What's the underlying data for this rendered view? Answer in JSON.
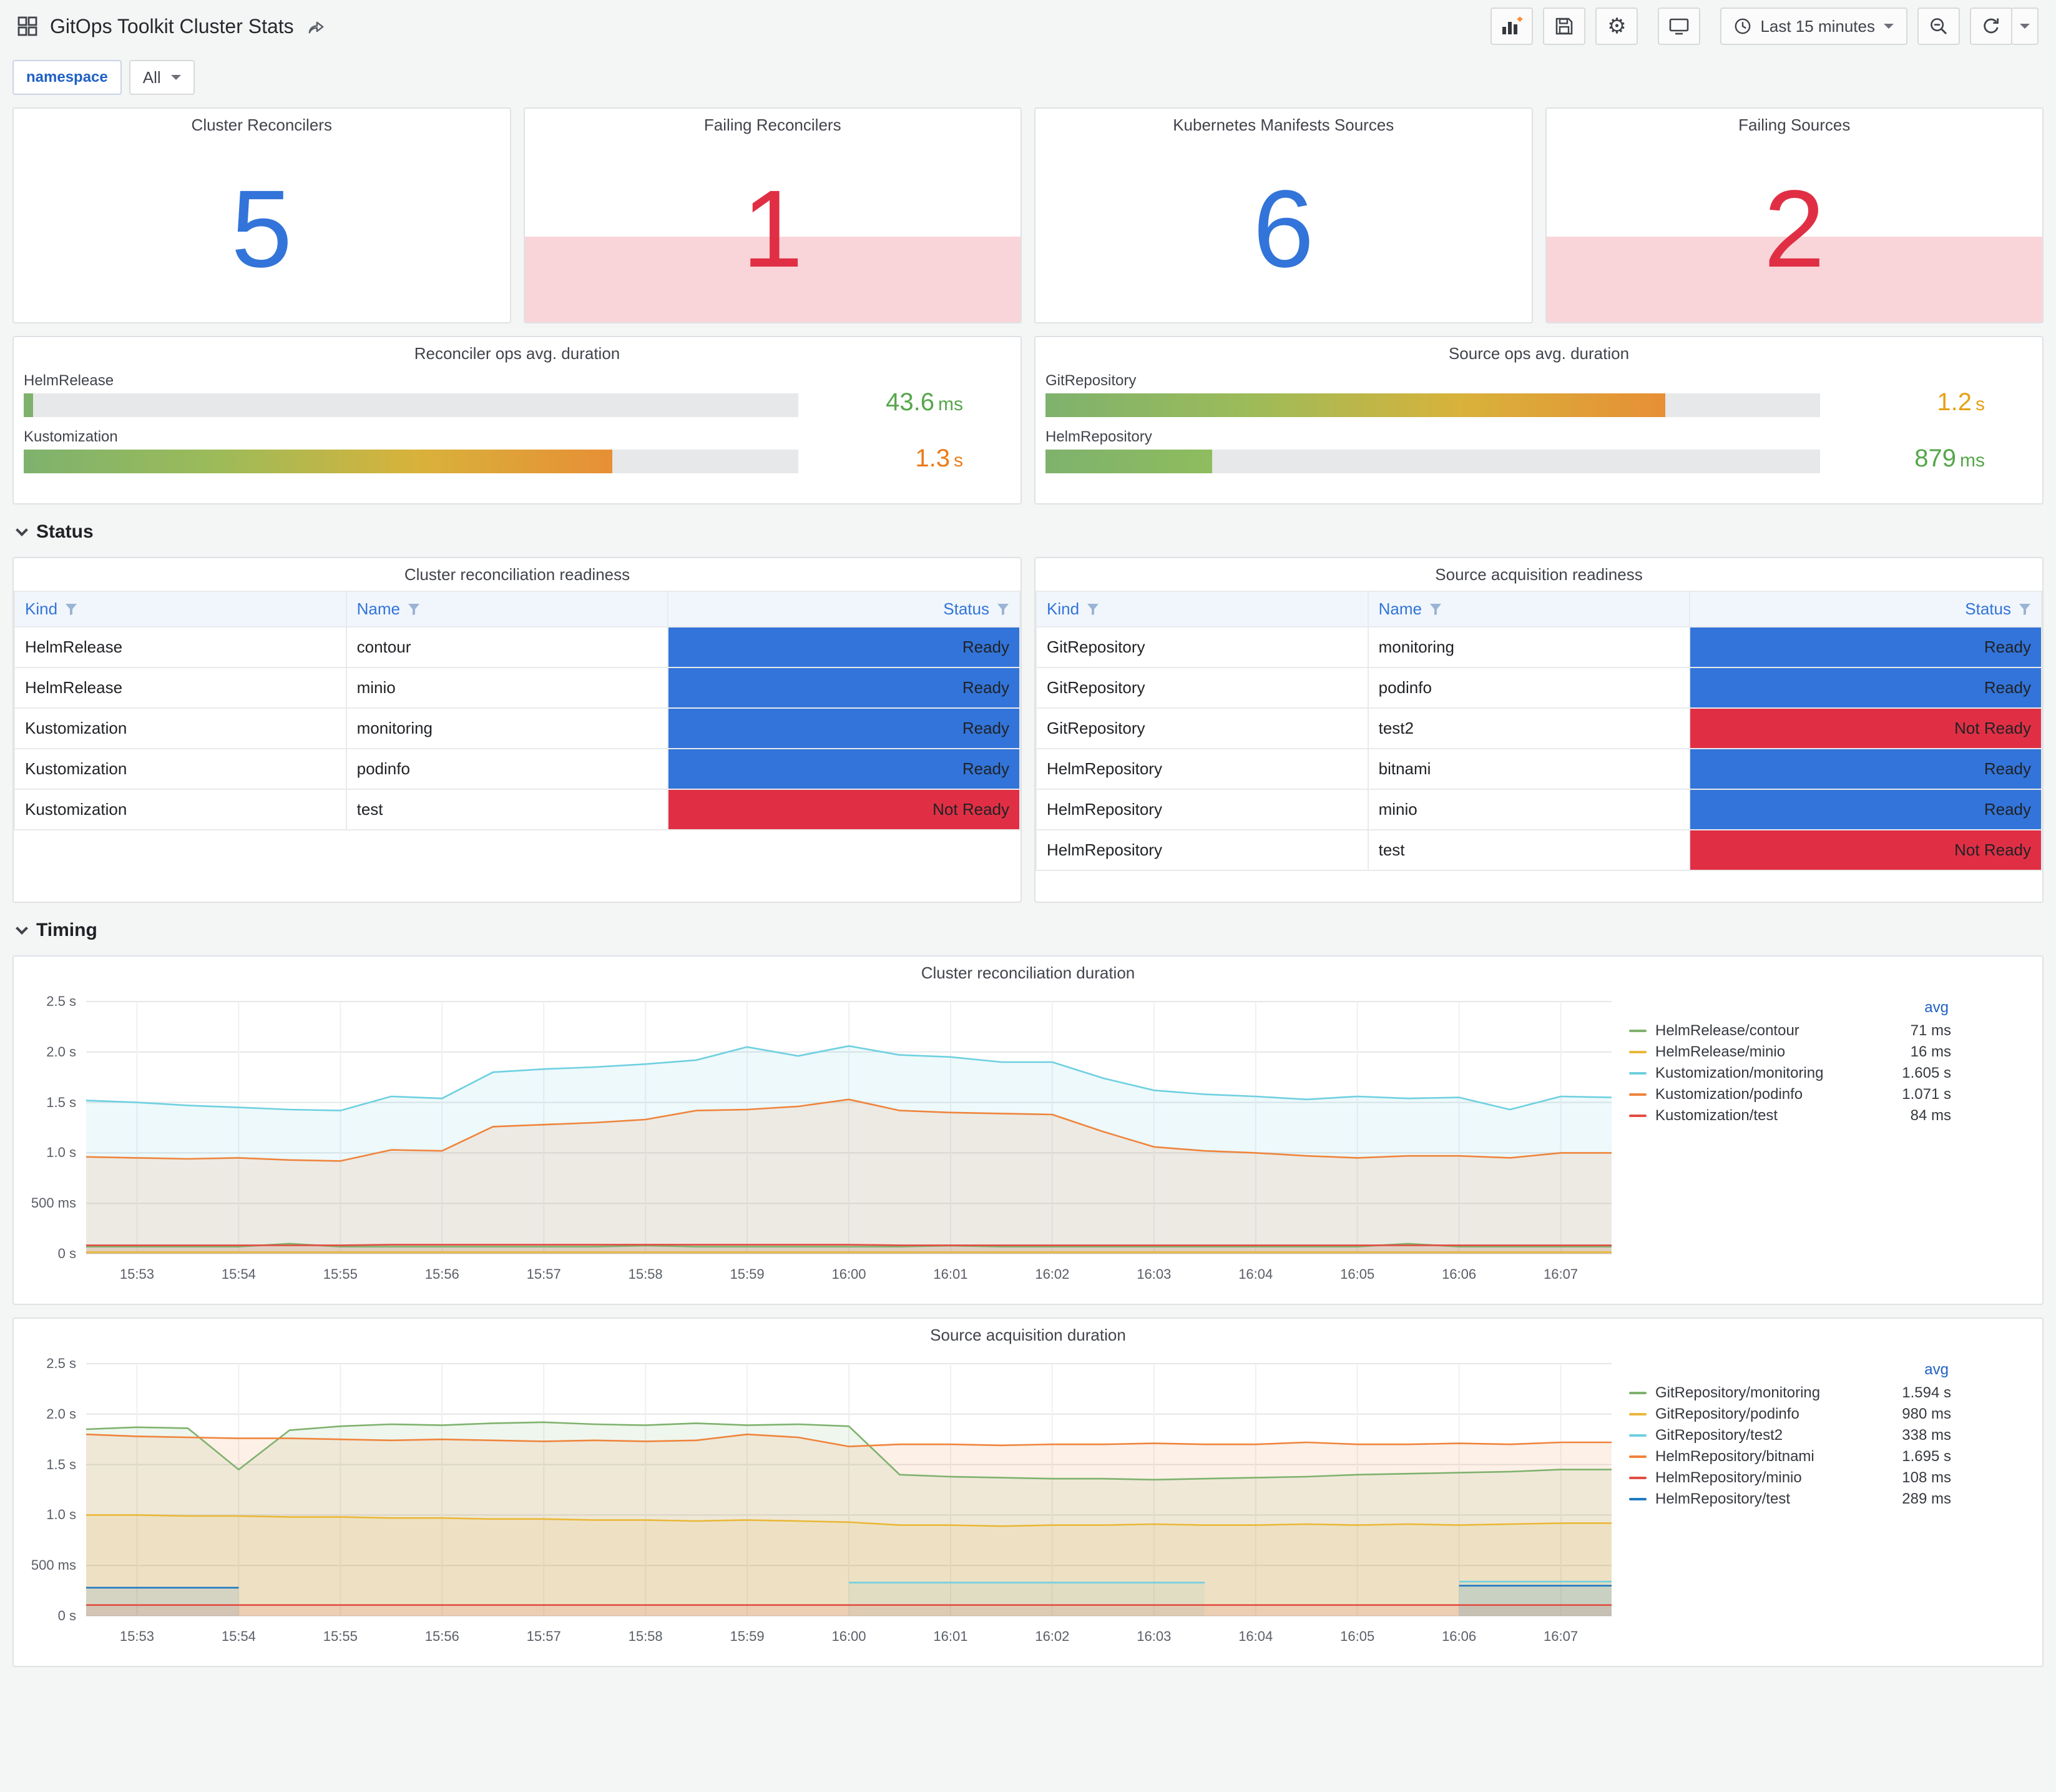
{
  "header": {
    "title": "GitOps Toolkit Cluster Stats",
    "time_picker": "Last 15 minutes"
  },
  "variables": {
    "label": "namespace",
    "value": "All"
  },
  "stats": [
    {
      "title": "Cluster Reconcilers",
      "value": "5",
      "color": "#3274D9",
      "alert": false
    },
    {
      "title": "Failing Reconcilers",
      "value": "1",
      "color": "#E02F44",
      "alert": true
    },
    {
      "title": "Kubernetes Manifests Sources",
      "value": "6",
      "color": "#3274D9",
      "alert": false
    },
    {
      "title": "Failing Sources",
      "value": "2",
      "color": "#E02F44",
      "alert": true
    }
  ],
  "gauges": [
    {
      "title": "Reconciler ops avg. duration",
      "rows": [
        {
          "label": "HelmRelease",
          "value": "43.6",
          "unit": "ms",
          "value_color": "#56A64B",
          "fraction": 0.012,
          "bar_stops": [
            "#7EB26D"
          ]
        },
        {
          "label": "Kustomization",
          "value": "1.3",
          "unit": "s",
          "value_color": "#EB7B18",
          "fraction": 0.76,
          "bar_stops": [
            "#7EB26D",
            "#9DBB59",
            "#D8B23B",
            "#E78F35"
          ]
        }
      ]
    },
    {
      "title": "Source ops avg. duration",
      "rows": [
        {
          "label": "GitRepository",
          "value": "1.2",
          "unit": "s",
          "value_color": "#E5A117",
          "fraction": 0.8,
          "bar_stops": [
            "#7EB26D",
            "#9DBB59",
            "#D8B23B",
            "#E78F35"
          ]
        },
        {
          "label": "HelmRepository",
          "value": "879",
          "unit": "ms",
          "value_color": "#56A64B",
          "fraction": 0.215,
          "bar_stops": [
            "#7EB26D",
            "#8FBC5E"
          ]
        }
      ]
    }
  ],
  "sections": {
    "status": "Status",
    "timing": "Timing"
  },
  "tables": [
    {
      "title": "Cluster reconciliation readiness",
      "columns": [
        "Kind",
        "Name",
        "Status"
      ],
      "rows": [
        [
          "HelmRelease",
          "contour",
          "Ready"
        ],
        [
          "HelmRelease",
          "minio",
          "Ready"
        ],
        [
          "Kustomization",
          "monitoring",
          "Ready"
        ],
        [
          "Kustomization",
          "podinfo",
          "Ready"
        ],
        [
          "Kustomization",
          "test",
          "Not Ready"
        ]
      ]
    },
    {
      "title": "Source acquisition readiness",
      "columns": [
        "Kind",
        "Name",
        "Status"
      ],
      "rows": [
        [
          "GitRepository",
          "monitoring",
          "Ready"
        ],
        [
          "GitRepository",
          "podinfo",
          "Ready"
        ],
        [
          "GitRepository",
          "test2",
          "Not Ready"
        ],
        [
          "HelmRepository",
          "bitnami",
          "Ready"
        ],
        [
          "HelmRepository",
          "minio",
          "Ready"
        ],
        [
          "HelmRepository",
          "test",
          "Not Ready"
        ]
      ]
    }
  ],
  "status_colors": {
    "Ready": "#3274D9",
    "Not Ready": "#E02F44"
  },
  "chart_data": [
    {
      "type": "line",
      "title": "Cluster reconciliation duration",
      "legend_header": "avg",
      "ylim": [
        0,
        2.5
      ],
      "y_tick_values": [
        0,
        0.5,
        1.0,
        1.5,
        2.0,
        2.5
      ],
      "y_ticks": [
        "0 s",
        "500 ms",
        "1.0 s",
        "1.5 s",
        "2.0 s",
        "2.5 s"
      ],
      "x_ticks": [
        "15:53",
        "15:54",
        "15:55",
        "15:56",
        "15:57",
        "15:58",
        "15:59",
        "16:00",
        "16:01",
        "16:02",
        "16:03",
        "16:04",
        "16:05",
        "16:06",
        "16:07"
      ],
      "series": [
        {
          "name": "HelmRelease/contour",
          "avg": "71 ms",
          "color": "#7EB26D",
          "values": [
            0.07,
            0.07,
            0.07,
            0.07,
            0.1,
            0.07,
            0.07,
            0.07,
            0.07,
            0.07,
            0.07,
            0.08,
            0.07,
            0.07,
            0.07,
            0.07,
            0.07,
            0.08,
            0.07,
            0.07,
            0.07,
            0.07,
            0.07,
            0.07,
            0.07,
            0.07,
            0.1,
            0.07,
            0.07,
            0.07,
            0.07
          ]
        },
        {
          "name": "HelmRelease/minio",
          "avg": "16 ms",
          "color": "#EAB839",
          "values": [
            0.016,
            0.016,
            0.016,
            0.016,
            0.016,
            0.016,
            0.016,
            0.016,
            0.016,
            0.016,
            0.016,
            0.016,
            0.016,
            0.016,
            0.016,
            0.016,
            0.016,
            0.016,
            0.016,
            0.016,
            0.016,
            0.016,
            0.016,
            0.016,
            0.016,
            0.016,
            0.016,
            0.016,
            0.016,
            0.016,
            0.016
          ]
        },
        {
          "name": "Kustomization/monitoring",
          "avg": "1.605 s",
          "color": "#6ED0E0",
          "values": [
            1.52,
            1.5,
            1.47,
            1.45,
            1.43,
            1.42,
            1.56,
            1.54,
            1.8,
            1.83,
            1.85,
            1.88,
            1.92,
            2.05,
            1.96,
            2.06,
            1.97,
            1.95,
            1.9,
            1.9,
            1.74,
            1.62,
            1.58,
            1.56,
            1.53,
            1.56,
            1.54,
            1.55,
            1.43,
            1.56,
            1.55
          ]
        },
        {
          "name": "Kustomization/podinfo",
          "avg": "1.071 s",
          "color": "#EF843C",
          "values": [
            0.96,
            0.95,
            0.94,
            0.95,
            0.93,
            0.92,
            1.03,
            1.02,
            1.26,
            1.28,
            1.3,
            1.33,
            1.42,
            1.43,
            1.46,
            1.53,
            1.42,
            1.4,
            1.39,
            1.38,
            1.21,
            1.06,
            1.02,
            1.0,
            0.97,
            0.95,
            0.97,
            0.97,
            0.95,
            1.0,
            1.0
          ]
        },
        {
          "name": "Kustomization/test",
          "avg": "84 ms",
          "color": "#E24D42",
          "values": [
            0.084,
            0.084,
            0.084,
            0.084,
            0.084,
            0.084,
            0.09,
            0.09,
            0.09,
            0.09,
            0.09,
            0.09,
            0.09,
            0.09,
            0.09,
            0.09,
            0.084,
            0.084,
            0.084,
            0.084,
            0.084,
            0.084,
            0.084,
            0.084,
            0.084,
            0.084,
            0.084,
            0.084,
            0.084,
            0.084,
            0.084
          ]
        }
      ]
    },
    {
      "type": "line",
      "title": "Source acquisition duration",
      "legend_header": "avg",
      "ylim": [
        0,
        2.5
      ],
      "y_tick_values": [
        0,
        0.5,
        1.0,
        1.5,
        2.0,
        2.5
      ],
      "y_ticks": [
        "0 s",
        "500 ms",
        "1.0 s",
        "1.5 s",
        "2.0 s",
        "2.5 s"
      ],
      "x_ticks": [
        "15:53",
        "15:54",
        "15:55",
        "15:56",
        "15:57",
        "15:58",
        "15:59",
        "16:00",
        "16:01",
        "16:02",
        "16:03",
        "16:04",
        "16:05",
        "16:06",
        "16:07"
      ],
      "series": [
        {
          "name": "GitRepository/monitoring",
          "avg": "1.594 s",
          "color": "#7EB26D",
          "values": [
            1.85,
            1.87,
            1.86,
            1.45,
            1.84,
            1.88,
            1.9,
            1.89,
            1.91,
            1.92,
            1.9,
            1.89,
            1.91,
            1.89,
            1.9,
            1.88,
            1.4,
            1.38,
            1.37,
            1.36,
            1.36,
            1.35,
            1.36,
            1.37,
            1.38,
            1.4,
            1.41,
            1.42,
            1.43,
            1.45,
            1.45
          ]
        },
        {
          "name": "GitRepository/podinfo",
          "avg": "980 ms",
          "color": "#EAB839",
          "values": [
            1.0,
            1.0,
            0.99,
            0.99,
            0.98,
            0.98,
            0.97,
            0.97,
            0.96,
            0.96,
            0.95,
            0.95,
            0.94,
            0.95,
            0.94,
            0.93,
            0.9,
            0.9,
            0.89,
            0.9,
            0.9,
            0.91,
            0.9,
            0.9,
            0.91,
            0.9,
            0.91,
            0.9,
            0.91,
            0.92,
            0.92
          ]
        },
        {
          "name": "GitRepository/test2",
          "avg": "338 ms",
          "color": "#6ED0E0",
          "values": [
            null,
            null,
            null,
            null,
            null,
            null,
            null,
            null,
            null,
            null,
            null,
            null,
            null,
            null,
            null,
            0.33,
            0.33,
            0.33,
            0.33,
            0.33,
            0.33,
            0.33,
            0.33,
            null,
            null,
            null,
            null,
            0.34,
            0.34,
            0.34,
            0.34
          ]
        },
        {
          "name": "HelmRepository/bitnami",
          "avg": "1.695 s",
          "color": "#EF843C",
          "values": [
            1.8,
            1.78,
            1.77,
            1.76,
            1.76,
            1.75,
            1.74,
            1.75,
            1.74,
            1.73,
            1.74,
            1.73,
            1.74,
            1.8,
            1.77,
            1.68,
            1.7,
            1.7,
            1.69,
            1.7,
            1.7,
            1.71,
            1.7,
            1.7,
            1.72,
            1.7,
            1.7,
            1.71,
            1.7,
            1.72,
            1.72
          ]
        },
        {
          "name": "HelmRepository/minio",
          "avg": "108 ms",
          "color": "#E24D42",
          "values": [
            0.108,
            0.108,
            0.108,
            0.108,
            0.108,
            0.108,
            0.108,
            0.108,
            0.108,
            0.108,
            0.108,
            0.108,
            0.108,
            0.108,
            0.108,
            0.108,
            0.108,
            0.108,
            0.108,
            0.108,
            0.108,
            0.108,
            0.108,
            0.108,
            0.108,
            0.108,
            0.108,
            0.108,
            0.108,
            0.108,
            0.108
          ]
        },
        {
          "name": "HelmRepository/test",
          "avg": "289 ms",
          "color": "#1F78C1",
          "values": [
            0.28,
            0.28,
            0.28,
            0.28,
            null,
            null,
            null,
            null,
            null,
            null,
            null,
            null,
            null,
            null,
            null,
            null,
            null,
            null,
            null,
            null,
            null,
            null,
            null,
            null,
            null,
            null,
            null,
            0.3,
            0.3,
            0.3,
            0.3
          ]
        }
      ]
    }
  ]
}
